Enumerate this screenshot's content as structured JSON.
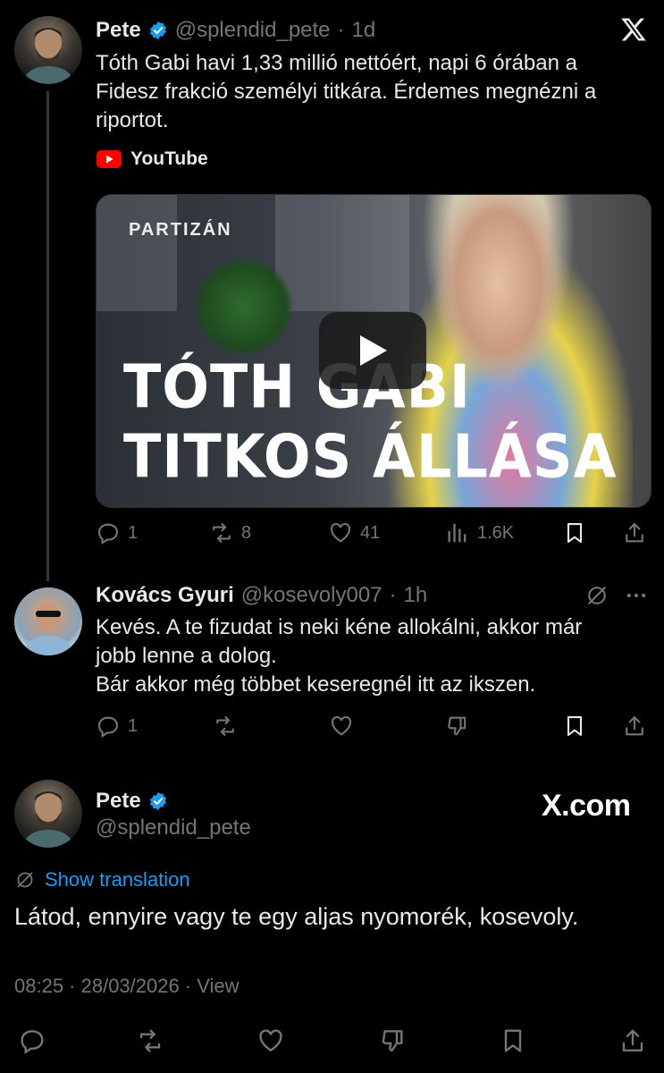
{
  "tweet1": {
    "name": "Pete",
    "handle": "@splendid_pete",
    "time": "1d",
    "text": "Tóth Gabi havi 1,33 millió nettóért, napi 6 órában a Fidesz frakció személyi titkára. Érdemes megnézni a riportot.",
    "source_label": "YouTube",
    "video": {
      "brand": "PARTIZÁN",
      "title_line1": "TÓTH GABI",
      "title_line2": "TITKOS ÁLLÁSA"
    },
    "actions": {
      "replies": "1",
      "reposts": "8",
      "likes": "41",
      "views": "1.6K"
    }
  },
  "tweet2": {
    "name": "Kovács Gyuri",
    "handle": "@kosevoly007",
    "time": "1h",
    "text_lines": [
      "Kevés. A te fizudat is neki kéne allokálni, akkor már",
      "jobb lenne a dolog.",
      "Bár akkor még többet keseregnél itt az ikszen."
    ],
    "actions": {
      "replies": "1"
    }
  },
  "tweet3": {
    "name": "Pete",
    "handle": "@splendid_pete",
    "site": "X.com",
    "show_translation": "Show translation",
    "text": "Látod, ennyire vagy te egy aljas nyomorék, kosevoly.",
    "timestamp": "08:25 · 28/03/2026 · View"
  },
  "colors": {
    "accent": "#1d9bf0",
    "muted": "#71767b",
    "youtube_red": "#ff0000"
  },
  "icons": [
    "x-logo-icon",
    "verified-icon",
    "youtube-icon",
    "play-icon",
    "reply-icon",
    "repost-icon",
    "like-icon",
    "views-icon",
    "bookmark-icon",
    "share-icon",
    "dislike-icon",
    "more-icon",
    "translate-icon"
  ]
}
